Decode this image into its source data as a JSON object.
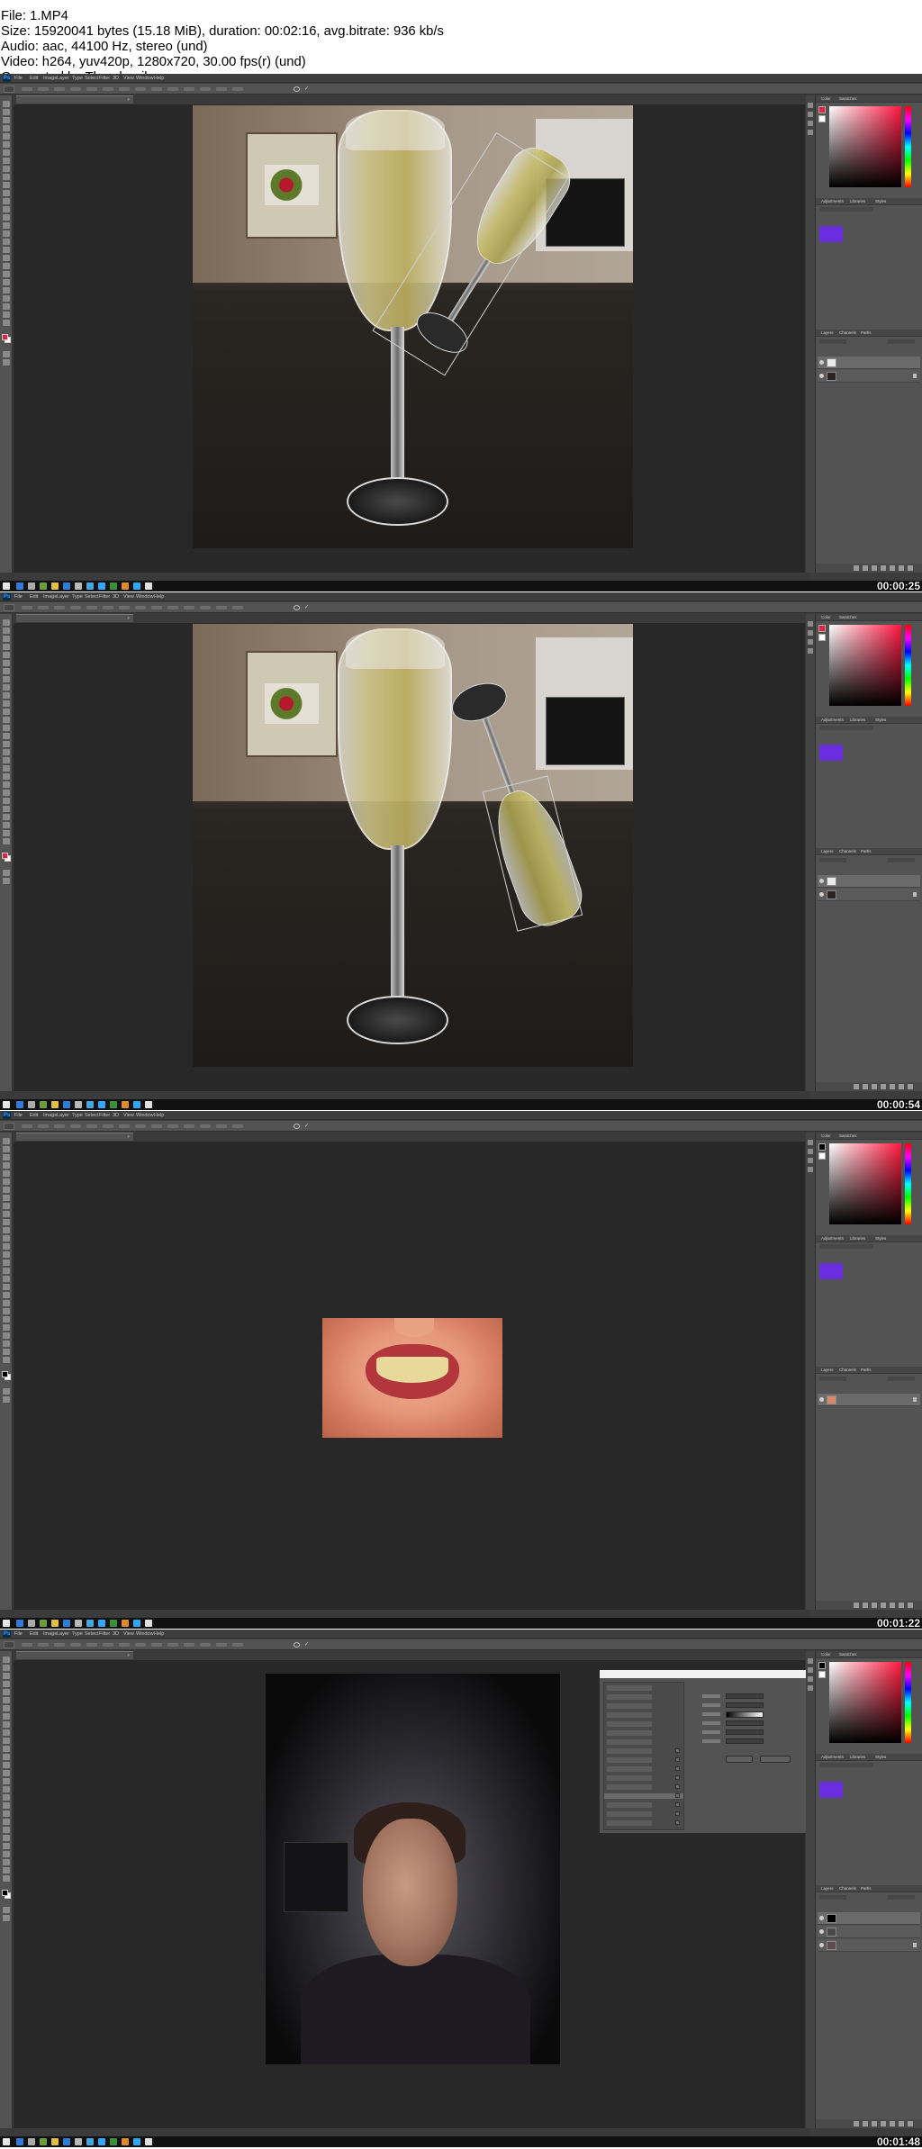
{
  "header": {
    "lines": [
      "File: 1.MP4",
      "Size: 15920041 bytes (15.18 MiB), duration: 00:02:16, avg.bitrate: 936 kb/s",
      "Audio: aac, 44100 Hz, stereo (und)",
      "Video: h264, yuv420p, 1280x720, 30.00 fps(r) (und)",
      "Generated by Thumbnail me"
    ]
  },
  "photoshop": {
    "menu": [
      "File",
      "Edit",
      "Image",
      "Layer",
      "Type",
      "Select",
      "Filter",
      "3D",
      "View",
      "Window",
      "Help"
    ],
    "panel_tabs": {
      "color": [
        "Color",
        "Swatches"
      ],
      "adjust": [
        "Adjustments",
        "Libraries",
        "Styles"
      ],
      "layers": [
        "Layers",
        "Channels",
        "Paths"
      ]
    },
    "colors": {
      "bg": "#3c3c3c",
      "workspace": "#282828",
      "panel": "#535353",
      "accent_swatch": "#6a2ee0"
    }
  },
  "frames": [
    {
      "id": "frame1",
      "timecode": "00:00:25",
      "scene": "champagne-transform-down"
    },
    {
      "id": "frame2",
      "timecode": "00:00:54",
      "scene": "champagne-transform-flipped"
    },
    {
      "id": "frame3",
      "timecode": "00:01:22",
      "scene": "smile"
    },
    {
      "id": "frame4",
      "timecode": "00:01:48",
      "scene": "portrait-layer-style"
    }
  ]
}
